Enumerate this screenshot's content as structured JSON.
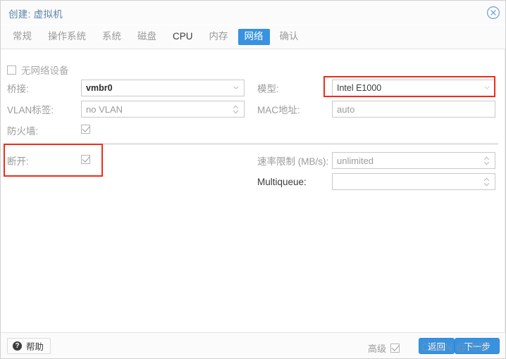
{
  "window": {
    "title": "创建: 虚拟机",
    "close_icon": "close-circle-icon"
  },
  "tabs": [
    {
      "label": "常规",
      "active": false
    },
    {
      "label": "操作系统",
      "active": false
    },
    {
      "label": "系统",
      "active": false
    },
    {
      "label": "磁盘",
      "active": false
    },
    {
      "label": "CPU",
      "active": false
    },
    {
      "label": "内存",
      "active": false
    },
    {
      "label": "网络",
      "active": true
    },
    {
      "label": "确认",
      "active": false
    }
  ],
  "form": {
    "no_network_device": {
      "label": "无网络设备",
      "checked": false
    },
    "left": {
      "bridge": {
        "label": "桥接:",
        "value": "vmbr0",
        "control": "combobox"
      },
      "vlan_tag": {
        "label": "VLAN标签:",
        "placeholder": "no VLAN",
        "control": "spinner"
      },
      "firewall": {
        "label": "防火墙:",
        "checked": true
      },
      "disconnect": {
        "label": "断开:",
        "checked": true,
        "highlighted": true
      }
    },
    "right": {
      "model": {
        "label": "模型:",
        "value": "Intel E1000",
        "control": "combobox",
        "highlighted": true
      },
      "mac_address": {
        "label": "MAC地址:",
        "placeholder": "auto",
        "control": "textfield"
      },
      "rate_limit": {
        "label": "速率限制 (MB/s):",
        "placeholder": "unlimited",
        "control": "spinner"
      },
      "multiqueue": {
        "label": "Multiqueue:",
        "placeholder": "",
        "control": "spinner"
      }
    }
  },
  "footer": {
    "help_label": "帮助",
    "help_icon": "question-mark-icon",
    "advanced_label": "高级",
    "advanced_checked": true,
    "back_label": "返回",
    "next_label": "下一步"
  },
  "watermark": {
    "text": "CSDN @杰瑞"
  },
  "colors": {
    "accent": "#3892e0",
    "title": "#5c84ad",
    "highlight": "#f52a17",
    "label": "#9b9b9b",
    "border": "#c9c9c9"
  }
}
